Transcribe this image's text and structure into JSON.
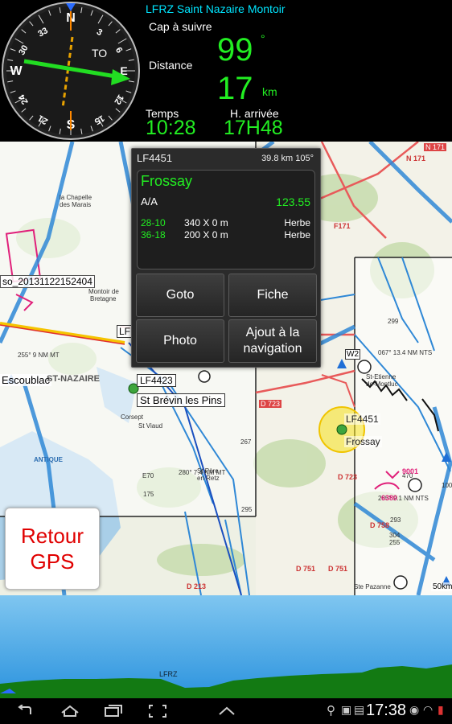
{
  "header": {
    "route": "LFRZ  Saint Nazaire Montoir",
    "heading_label": "Cap à suivre",
    "heading_value": "99",
    "heading_unit": "°",
    "distance_label": "Distance",
    "distance_value": "17",
    "distance_unit": "km",
    "time_label": "Temps",
    "time_value": "10:28",
    "arrival_label": "H. arrivée",
    "arrival_value": "17H48"
  },
  "compass": {
    "to_label": "TO",
    "cardinals": [
      "N",
      "3",
      "6",
      "E",
      "12",
      "15",
      "S",
      "21",
      "24",
      "W",
      "30",
      "33"
    ]
  },
  "popup": {
    "code": "LF4451",
    "dist_bearing": "39.8 km  105°",
    "name": "Frossay",
    "freq_label": "A/A",
    "freq_value": "123.55",
    "runways": [
      {
        "id": "28-10",
        "size": "340 X 0 m",
        "surface": "Herbe"
      },
      {
        "id": "36-18",
        "size": "200 X 0 m",
        "surface": "Herbe"
      }
    ],
    "buttons": {
      "goto": "Goto",
      "fiche": "Fiche",
      "photo": "Photo",
      "ajout_line1": "Ajout à la",
      "ajout_line2": "navigation"
    }
  },
  "map": {
    "labels": {
      "so_track": "so_20131122152404",
      "escoublac": "Escoublac",
      "saint_nazaire": "ST-NAZAIRE",
      "lf4423": "LF4423",
      "st_brevin": "St Brévin les Pins",
      "lf4451": "LF4451",
      "frossay": "Frossay",
      "lfrz_map": "LFRZ",
      "n171": "N 171",
      "d723": "D 723",
      "w2": "W2",
      "scale": "50km"
    }
  },
  "retour": {
    "line1": "Retour",
    "line2": "GPS"
  },
  "profile": {
    "label": "LFRZ"
  },
  "navbar": {
    "time": "17:38"
  },
  "colors": {
    "accent_green": "#22ee22",
    "route_cyan": "#00e5ff",
    "retour_red": "#e00000",
    "sky": "#2b93de",
    "terrain": "#117711"
  }
}
